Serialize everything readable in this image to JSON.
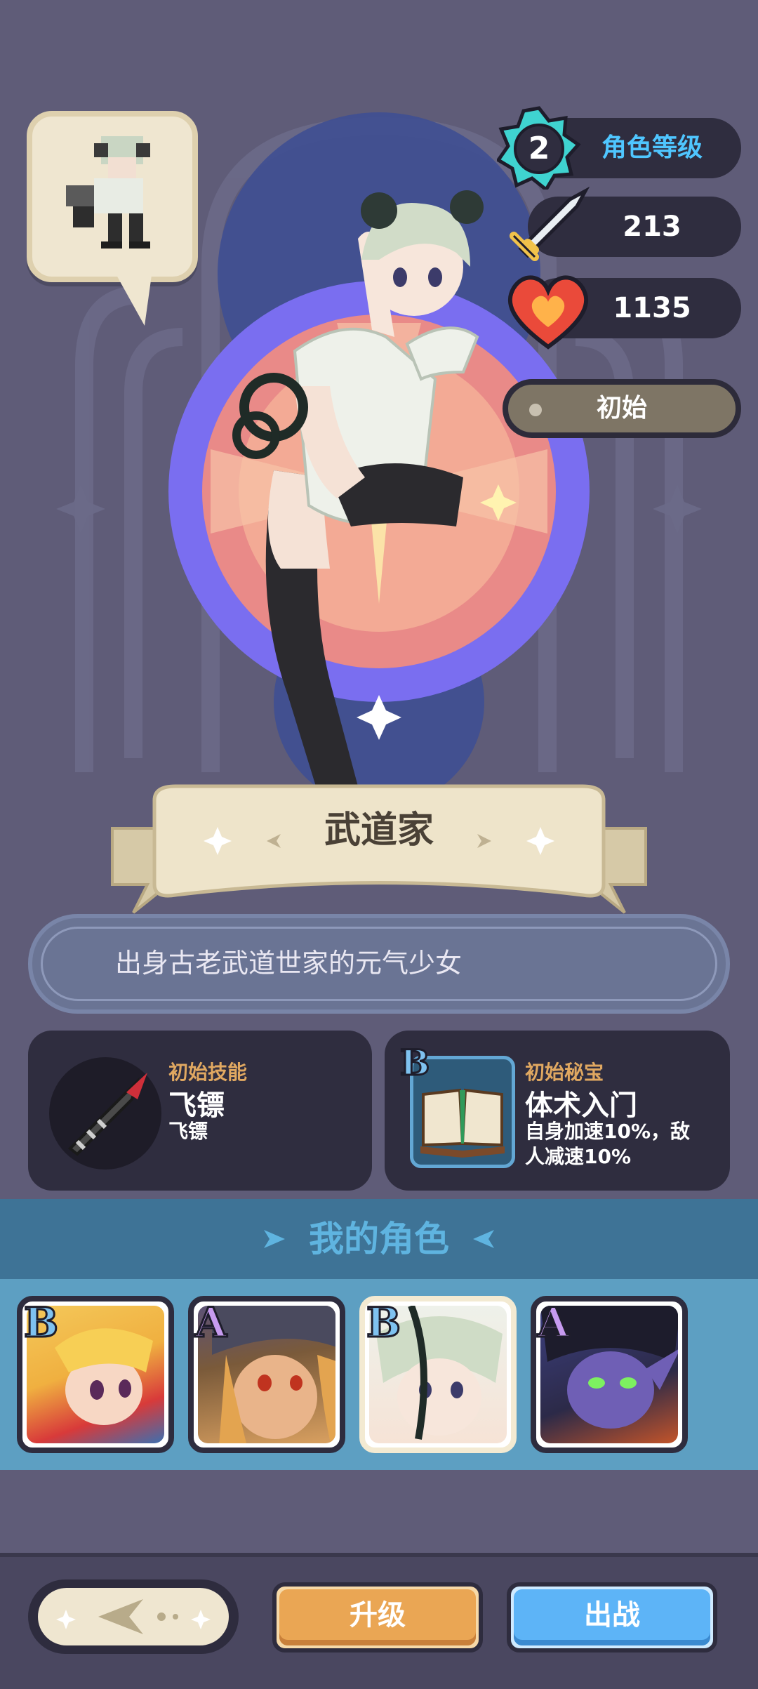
{
  "stats": {
    "level": "2",
    "level_label": "角色等级",
    "attack": "213",
    "health": "1135",
    "rarity": "初始"
  },
  "character": {
    "name": "武道家",
    "description": "出身古老武道世家的元气少女"
  },
  "skill_card": {
    "caption": "初始技能",
    "title": "飞镖",
    "subtitle": "飞镖"
  },
  "relic_card": {
    "caption": "初始秘宝",
    "grade": "B",
    "title": "体术入门",
    "description_line1": "自身加速10%，敌",
    "description_line2": "人减速10%"
  },
  "roster": {
    "title": "我的角色",
    "characters": [
      {
        "grade": "B",
        "icon": "blonde-swordsman-portrait"
      },
      {
        "grade": "A",
        "icon": "hooded-witch-portrait"
      },
      {
        "grade": "B",
        "icon": "martial-artist-portrait"
      },
      {
        "grade": "A",
        "icon": "dark-elf-portrait"
      }
    ]
  },
  "buttons": {
    "upgrade": "升级",
    "deploy": "出战"
  },
  "colors": {
    "background": "#5f5c78",
    "level_accent": "#4fc6ff",
    "upgrade": "#eaa654",
    "deploy": "#5db4f7",
    "card_caption": "#e0a861"
  }
}
